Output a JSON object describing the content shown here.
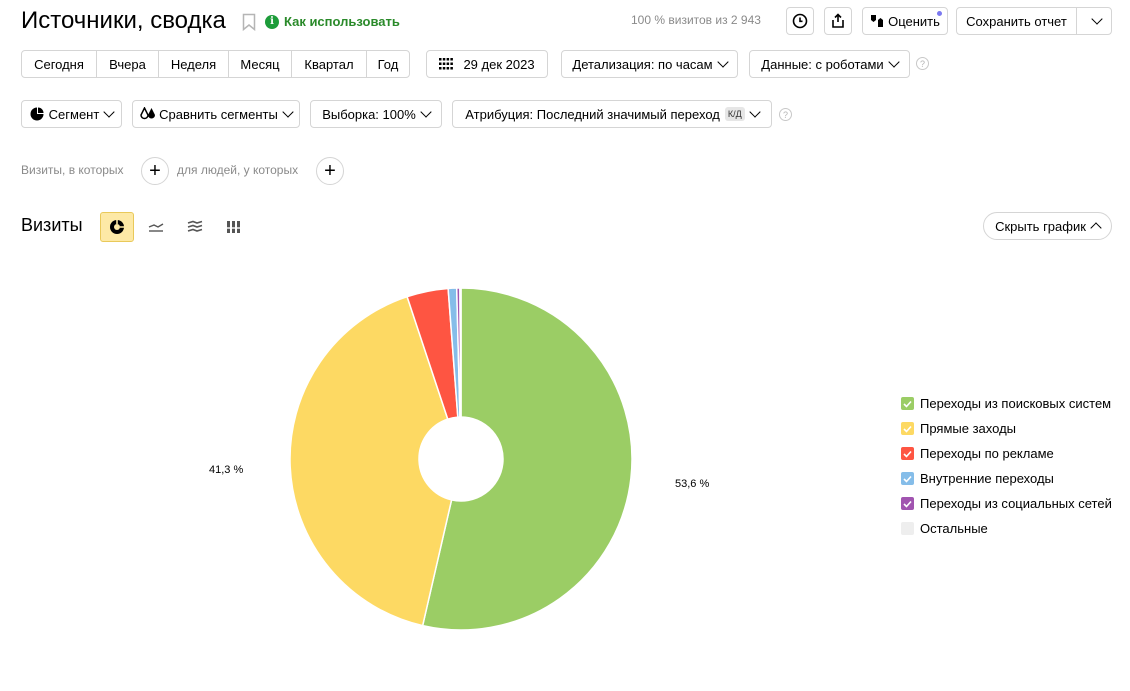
{
  "header": {
    "title": "Источники, сводка",
    "how_to_use": "Как использовать",
    "visits_info": "100 % визитов из 2 943",
    "rate_label": "Оценить",
    "save_report": "Сохранить отчет"
  },
  "period": {
    "options": [
      "Сегодня",
      "Вчера",
      "Неделя",
      "Месяц",
      "Квартал",
      "Год"
    ],
    "date": "29 дек 2023",
    "detail": "Детализация: по часам",
    "data_mode": "Данные: с роботами"
  },
  "toolbar": {
    "segment": "Сегмент",
    "compare": "Сравнить сегменты",
    "sample": "Выборка: 100%",
    "attribution": "Атрибуция: Последний значимый переход",
    "attribution_badge": "К/Д"
  },
  "filters": {
    "visits_label": "Визиты, в которых",
    "people_label": "для людей, у которых"
  },
  "section": {
    "title": "Визиты",
    "hide_chart": "Скрыть график"
  },
  "colors": {
    "search": "#9bcd65",
    "direct": "#fdd963",
    "ads": "#fe5542",
    "internal": "#85bde9",
    "social": "#a154b0",
    "other": "#eeeeee"
  },
  "chart_data": {
    "type": "pie",
    "labels_shown": [
      "53,6 %",
      "41,3 %"
    ],
    "slices": [
      {
        "name": "Переходы из поисковых систем",
        "value": 53.6,
        "color": "#9bcd65"
      },
      {
        "name": "Прямые заходы",
        "value": 41.3,
        "color": "#fdd963"
      },
      {
        "name": "Переходы по рекламе",
        "value": 3.9,
        "color": "#fe5542"
      },
      {
        "name": "Внутренние переходы",
        "value": 0.8,
        "color": "#85bde9"
      },
      {
        "name": "Переходы из социальных сетей",
        "value": 0.3,
        "color": "#a154b0"
      },
      {
        "name": "Остальные",
        "value": 0.1,
        "color": "#eeeeee"
      }
    ]
  },
  "legend": [
    {
      "label": "Переходы из поисковых систем",
      "color": "#9bcd65"
    },
    {
      "label": "Прямые заходы",
      "color": "#fdd963"
    },
    {
      "label": "Переходы по рекламе",
      "color": "#fe5542"
    },
    {
      "label": "Внутренние переходы",
      "color": "#85bde9"
    },
    {
      "label": "Переходы из социальных сетей",
      "color": "#a154b0"
    },
    {
      "label": "Остальные",
      "color": "#eeeeee"
    }
  ]
}
